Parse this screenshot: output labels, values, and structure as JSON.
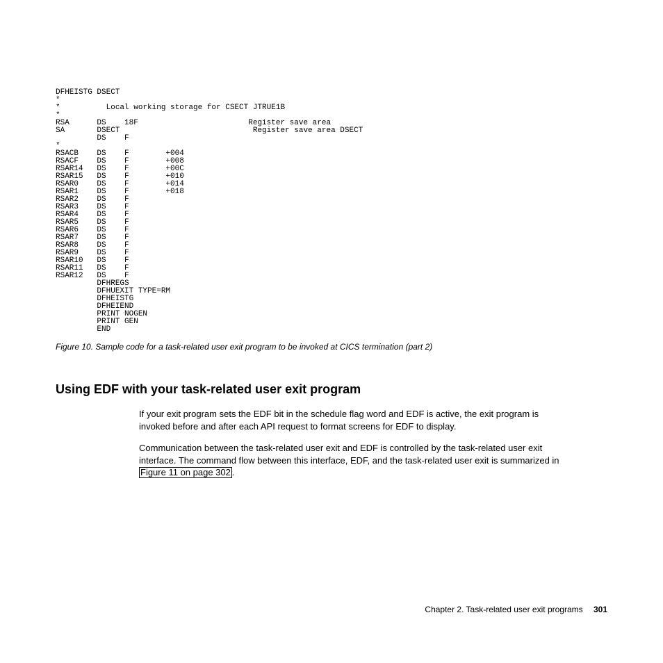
{
  "code": "DFHEISTG DSECT\n*\n*          Local working storage for CSECT JTRUE1B\n*\nRSA      DS    18F                        Register save area\nSA       DSECT                             Register save area DSECT\n         DS    F\n*\nRSACB    DS    F        +004\nRSACF    DS    F        +008\nRSAR14   DS    F        +00C\nRSAR15   DS    F        +010\nRSAR0    DS    F        +014\nRSAR1    DS    F        +018\nRSAR2    DS    F\nRSAR3    DS    F\nRSAR4    DS    F\nRSAR5    DS    F\nRSAR6    DS    F\nRSAR7    DS    F\nRSAR8    DS    F\nRSAR9    DS    F\nRSAR10   DS    F\nRSAR11   DS    F\nRSAR12   DS    F\n         DFHREGS\n         DFHUEXIT TYPE=RM\n         DFHEISTG\n         DFHEIEND\n         PRINT NOGEN\n         PRINT GEN\n         END",
  "caption": "Figure 10. Sample code for a task-related user exit program to be invoked at CICS termination (part 2)",
  "heading": "Using EDF with your task-related user exit program",
  "para1": "If your exit program sets the EDF bit in the schedule flag word and EDF is active, the exit program is invoked before and after each API request to format screens for EDF to display.",
  "para2_1": "Communication between the task-related user exit and EDF is controlled by the task-related user exit interface. The command flow between this interface, EDF, and the task-related user exit is summarized in ",
  "xref_text": "Figure 11 on page 302",
  "para2_3": ".",
  "footer_chapter": "Chapter 2. Task-related user exit programs",
  "footer_page": "301"
}
